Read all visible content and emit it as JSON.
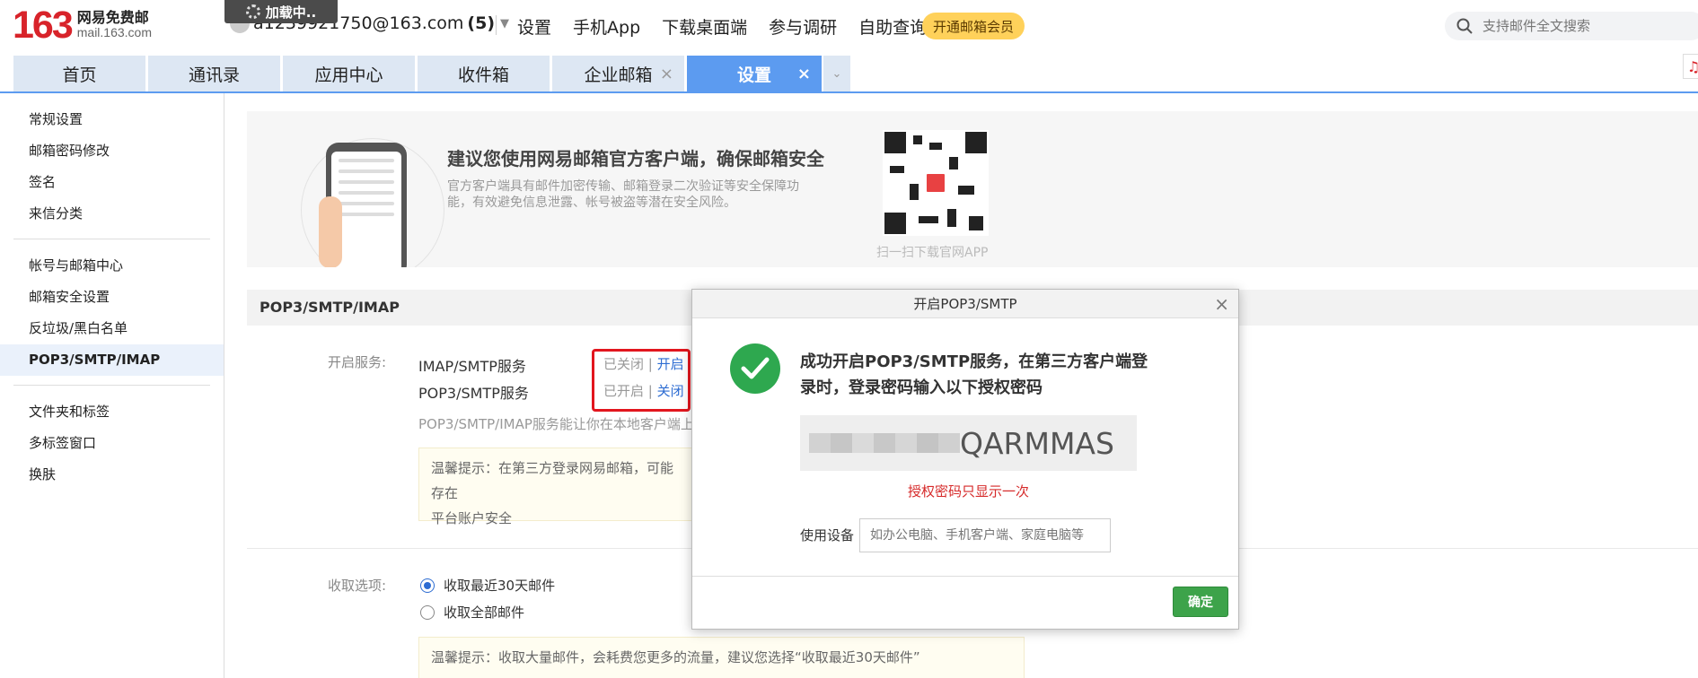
{
  "header": {
    "logo_number": "163",
    "logo_cn": "网易免费邮",
    "logo_en": "mail.163.com",
    "loading_text": "加载中..",
    "account_email": "a1239921750@163.com",
    "account_unread": "(5)",
    "links": [
      "设置",
      "手机App",
      "下载桌面端",
      "参与调研",
      "自助查询"
    ],
    "vip_label": "开通邮箱会员",
    "search_placeholder": "支持邮件全文搜索"
  },
  "tabs": [
    {
      "label": "首页"
    },
    {
      "label": "通讯录"
    },
    {
      "label": "应用中心"
    },
    {
      "label": "收件箱"
    },
    {
      "label": "企业邮箱"
    },
    {
      "label": "设置"
    }
  ],
  "sidebar": {
    "group1": [
      "常规设置",
      "邮箱密码修改",
      "签名",
      "来信分类"
    ],
    "group2": [
      "帐号与邮箱中心",
      "邮箱安全设置",
      "反垃圾/黑白名单",
      "POP3/SMTP/IMAP"
    ],
    "group3": [
      "文件夹和标签",
      "多标签窗口",
      "换肤"
    ],
    "active": "POP3/SMTP/IMAP"
  },
  "banner": {
    "title": "建议您使用网易邮箱官方客户端，确保邮箱安全",
    "desc": "官方客户端具有邮件加密传输、邮箱登录二次验证等安全保障功能，有效避免信息泄露、帐号被盗等潜在安全风险。",
    "qr_caption": "扫一扫下载官网APP"
  },
  "section": {
    "title": "POP3/SMTP/IMAP",
    "service_label": "开启服务:",
    "imap_name": "IMAP/SMTP服务",
    "imap_status": "已关闭",
    "imap_action": "开启",
    "pop_name": "POP3/SMTP服务",
    "pop_status": "已开启",
    "pop_action": "关闭",
    "desc": "POP3/SMTP/IMAP服务能让你在本地客户端上",
    "tip1_line1": "温馨提示：在第三方登录网易邮箱，可能存在",
    "tip1_line2": "平台账户安全",
    "receive_label": "收取选项:",
    "radio_recent": "收取最近30天邮件",
    "radio_all": "收取全部邮件",
    "tip2": "温馨提示：收取大量邮件，会耗费您更多的流量，建议您选择“收取最近30天邮件”"
  },
  "dialog": {
    "title": "开启POP3/SMTP",
    "close": "×",
    "success": "成功开启POP3/SMTP服务，在第三方客户端登录时，登录密码输入以下授权密码",
    "code_visible": "QARMMAS",
    "code_note": "授权密码只显示一次",
    "device_label": "使用设备",
    "device_placeholder": "如办公电脑、手机客户端、家庭电脑等",
    "confirm": "确定"
  },
  "colors": {
    "brand_red": "#d8232a",
    "tab_active": "#5c9bf0",
    "success_green": "#2ea84f",
    "link_blue": "#2d6cd2",
    "highlight_red": "#e2161e"
  }
}
